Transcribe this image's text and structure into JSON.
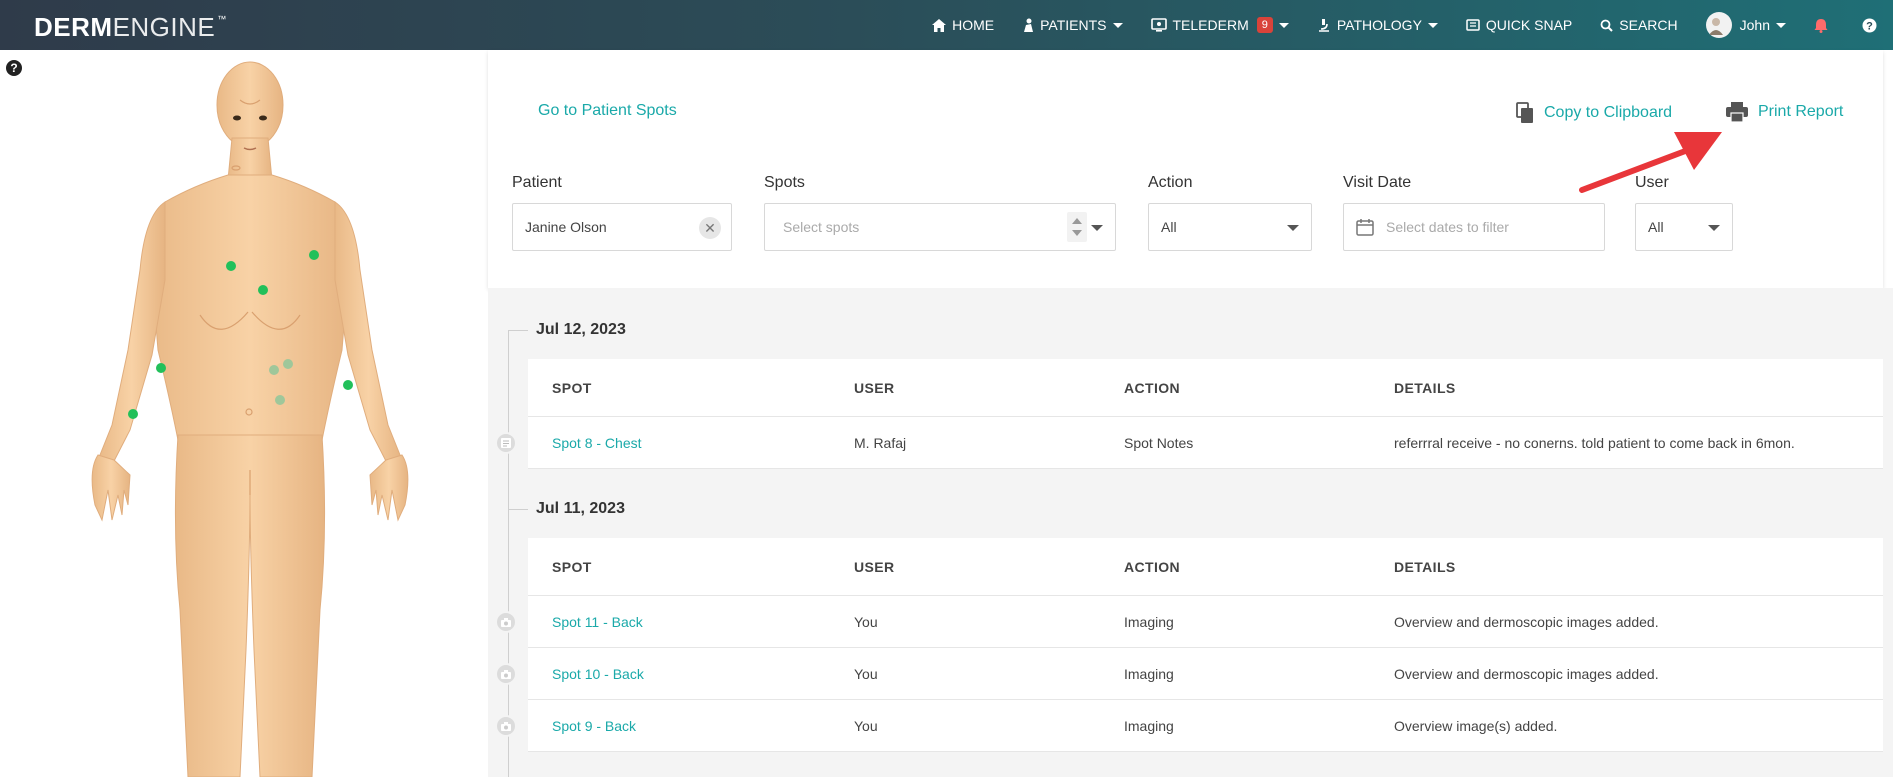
{
  "app": {
    "logo_bold": "DERM",
    "logo_light": "ENGINE",
    "logo_tm": "™"
  },
  "nav": {
    "home": "HOME",
    "patients": "PATIENTS",
    "telederm": "TELEDERM",
    "telederm_badge": "9",
    "pathology": "PATHOLOGY",
    "quick_snap": "QUICK SNAP",
    "search": "SEARCH",
    "user": "John"
  },
  "help_left": "?",
  "actions": {
    "go_to_spots": "Go to Patient Spots",
    "copy": "Copy to Clipboard",
    "print": "Print Report"
  },
  "filters": {
    "patient_label": "Patient",
    "patient_value": "Janine Olson",
    "spots_label": "Spots",
    "spots_placeholder": "Select spots",
    "action_label": "Action",
    "action_value": "All",
    "visit_label": "Visit Date",
    "visit_placeholder": "Select dates to filter",
    "user_label": "User",
    "user_value": "All"
  },
  "columns": [
    "SPOT",
    "USER",
    "ACTION",
    "DETAILS"
  ],
  "groups": [
    {
      "date": "Jul 12, 2023",
      "rows": [
        {
          "spot": "Spot 8 - Chest",
          "user": "M. Rafaj",
          "action": "Spot Notes",
          "details": "referrral receive - no conerns. told patient to come back in 6mon.",
          "icon": "notes-icon"
        }
      ]
    },
    {
      "date": "Jul 11, 2023",
      "rows": [
        {
          "spot": "Spot 11 - Back",
          "user": "You",
          "action": "Imaging",
          "details": "Overview and dermoscopic images added.",
          "icon": "camera-icon"
        },
        {
          "spot": "Spot 10 - Back",
          "user": "You",
          "action": "Imaging",
          "details": "Overview and dermoscopic images added.",
          "icon": "camera-icon"
        },
        {
          "spot": "Spot 9 - Back",
          "user": "You",
          "action": "Imaging",
          "details": "Overview image(s) added.",
          "icon": "camera-icon"
        }
      ]
    }
  ],
  "colors": {
    "accent": "#1aa9a9",
    "spot_marker": "#22c05a",
    "arrow": "#e8363a"
  }
}
